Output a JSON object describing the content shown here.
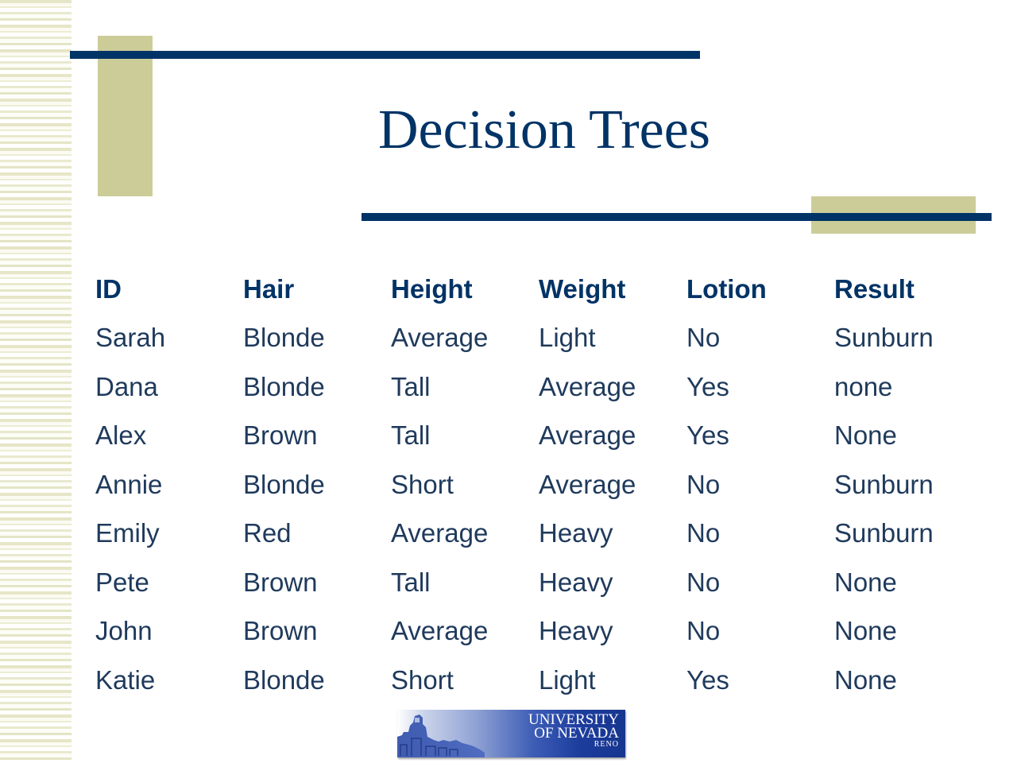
{
  "slide": {
    "title": "Decision Trees",
    "colors": {
      "navy": "#003366",
      "khaki": "#cccc99",
      "body_text": "#1f3a5c"
    }
  },
  "table": {
    "headers": [
      "ID",
      "Hair",
      "Height",
      "Weight",
      "Lotion",
      "Result"
    ],
    "rows": [
      [
        "Sarah",
        "Blonde",
        "Average",
        "Light",
        "No",
        "Sunburn"
      ],
      [
        "Dana",
        "Blonde",
        "Tall",
        "Average",
        "Yes",
        "none"
      ],
      [
        "Alex",
        "Brown",
        "Tall",
        "Average",
        "Yes",
        "None"
      ],
      [
        "Annie",
        "Blonde",
        "Short",
        "Average",
        "No",
        "Sunburn"
      ],
      [
        "Emily",
        "Red",
        "Average",
        "Heavy",
        "No",
        "Sunburn"
      ],
      [
        "Pete",
        "Brown",
        "Tall",
        "Heavy",
        "No",
        "None"
      ],
      [
        "John",
        "Brown",
        "Average",
        "Heavy",
        "No",
        "None"
      ],
      [
        "Katie",
        "Blonde",
        "Short",
        "Light",
        "Yes",
        "None"
      ]
    ]
  },
  "logo": {
    "line1": "UNIVERSITY",
    "line2": "OF NEVADA",
    "line3": "RENO",
    "icon": "campus-building-icon"
  }
}
